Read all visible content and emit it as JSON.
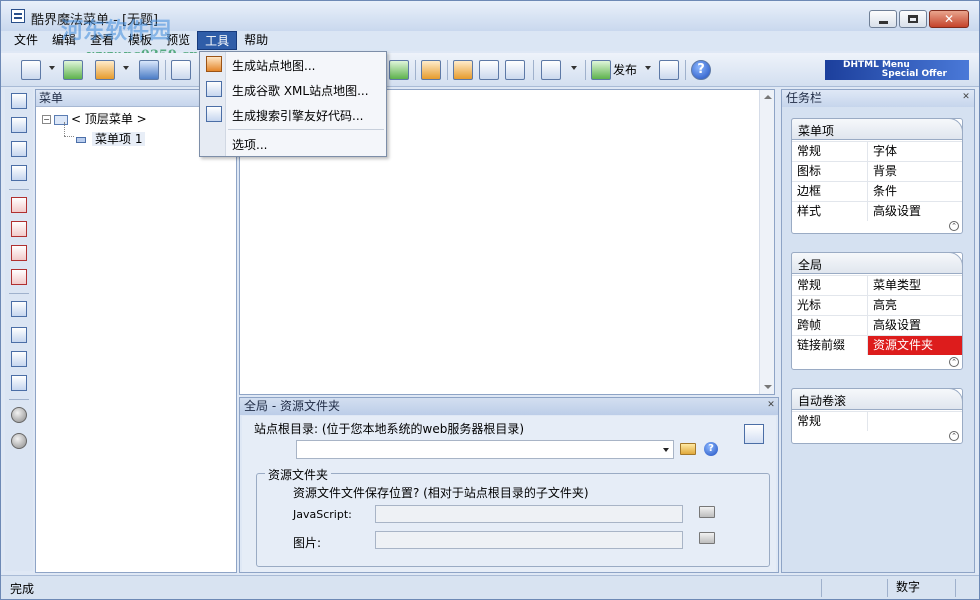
{
  "window": {
    "title": "酷界魔法菜单 - [无题]"
  },
  "watermark": {
    "text": "河东软件园",
    "url": "www.pc0359.cn"
  },
  "menubar": [
    "文件",
    "编辑",
    "查看",
    "模板",
    "预览",
    "工具",
    "帮助"
  ],
  "toolbar": {
    "publish_label": "发布",
    "ad_line1": "DHTML Menu",
    "ad_line2": "Special Offer"
  },
  "tools_menu": {
    "items": [
      "生成站点地图...",
      "生成谷歌 XML站点地图...",
      "生成搜索引擎友好代码...",
      "选项..."
    ]
  },
  "tree": {
    "header": "菜单",
    "root_label": "< 顶层菜单 >",
    "child_label": "菜单项 1"
  },
  "props": {
    "header": "全局 - 资源文件夹",
    "site_root_label": "站点根目录: (位于您本地系统的web服务器根目录)",
    "site_root_value": "",
    "group_title": "资源文件夹",
    "group_desc": "资源文件文件保存位置? (相对于站点根目录的子文件夹)",
    "js_label": "JavaScript:",
    "js_value": "",
    "img_label": "图片:",
    "img_value": ""
  },
  "taskpane": {
    "header": "任务栏",
    "sections": [
      {
        "title": "菜单项",
        "rows": [
          [
            "常规",
            "字体"
          ],
          [
            "图标",
            "背景"
          ],
          [
            "边框",
            "条件"
          ],
          [
            "样式",
            "高级设置"
          ]
        ]
      },
      {
        "title": "全局",
        "rows": [
          [
            "常规",
            "菜单类型"
          ],
          [
            "光标",
            "高亮"
          ],
          [
            "跨帧",
            "高级设置"
          ],
          [
            "链接前缀",
            "资源文件夹"
          ]
        ]
      },
      {
        "title": "自动卷滚",
        "rows": [
          [
            "常规",
            ""
          ]
        ]
      }
    ]
  },
  "status": {
    "left": "完成",
    "cell": "数字"
  },
  "colors": {
    "accent": "#2f5da8",
    "highlight": "#dd1c1c",
    "ad_bg": "#1c3f9c"
  }
}
